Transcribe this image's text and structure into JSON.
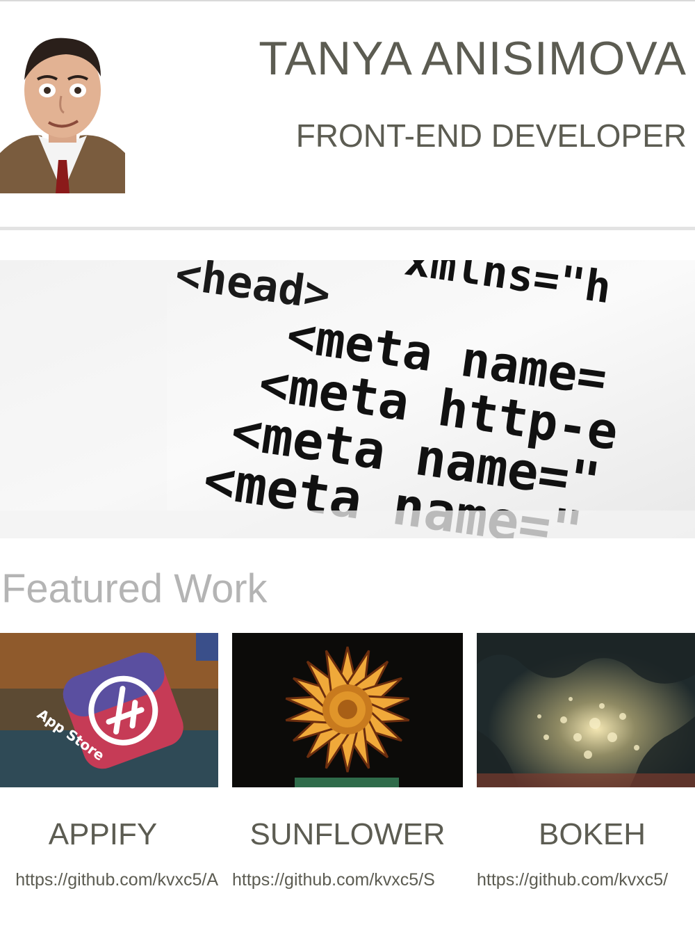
{
  "header": {
    "name": "TANYA ANISIMOVA",
    "role": "FRONT-END DEVELOPER"
  },
  "hero": {
    "code_lines": [
      "<head>",
      "xmlns=\"h",
      "<meta name=",
      "<meta http-e",
      "<meta name=\"",
      "<meta name=\""
    ]
  },
  "featured": {
    "title": "Featured Work",
    "projects": [
      {
        "title": "APPIFY",
        "url": "https://github.com/kvxc5/A",
        "thumb_label": "App Store",
        "thumb_icon": "app-store-icon"
      },
      {
        "title": "SUNFLOWER",
        "url": "https://github.com/kvxc5/S",
        "thumb_icon": "sunflower-image"
      },
      {
        "title": "BOKEH",
        "url": "https://github.com/kvxc5/",
        "thumb_icon": "bokeh-image"
      }
    ]
  },
  "colors": {
    "text_dark": "#5c5c52",
    "text_muted": "#b4b4b4",
    "divider": "#e3e3e3"
  }
}
